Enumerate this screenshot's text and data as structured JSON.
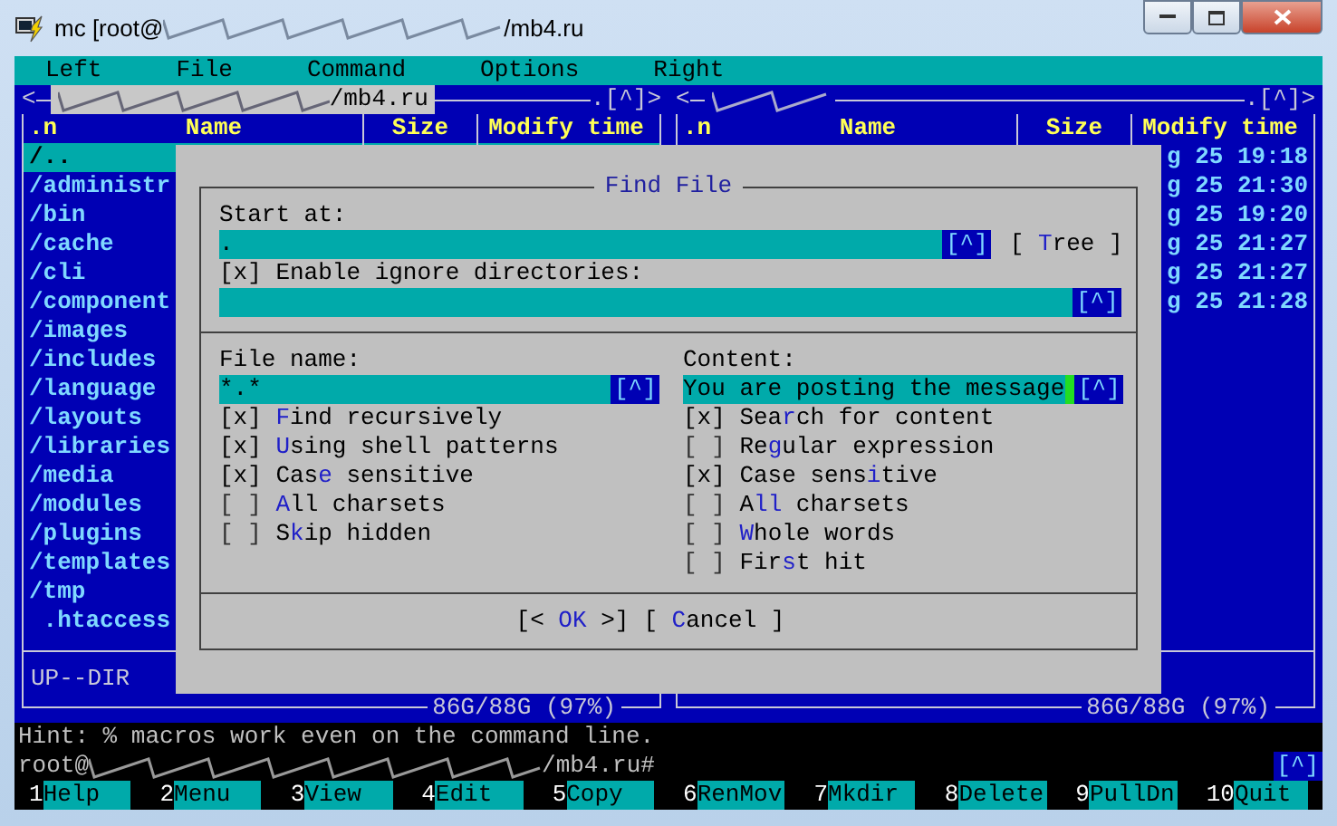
{
  "window": {
    "title_prefix": "mc [root@",
    "title_suffix": "/mb4.ru"
  },
  "menu": [
    {
      "label": "Left"
    },
    {
      "label": "File"
    },
    {
      "label": "Command"
    },
    {
      "label": "Options"
    },
    {
      "label": "Right"
    }
  ],
  "panels": [
    {
      "marker": "<",
      "path": "/mb4.ru",
      "active": true,
      "history": ".[^]>",
      "sort": ".n",
      "columns": [
        "Name",
        "Size",
        "Modify time"
      ],
      "status": "UP--DIR",
      "free": "86G/88G (97%)",
      "rows": [
        {
          "name": "/..",
          "selected": true
        },
        {
          "name": "/administr",
          "selected": false
        },
        {
          "name": "/bin",
          "selected": false
        },
        {
          "name": "/cache",
          "selected": false
        },
        {
          "name": "/cli",
          "selected": false
        },
        {
          "name": "/component",
          "selected": false
        },
        {
          "name": "/images",
          "selected": false
        },
        {
          "name": "/includes",
          "selected": false
        },
        {
          "name": "/language",
          "selected": false
        },
        {
          "name": "/layouts",
          "selected": false
        },
        {
          "name": "/libraries",
          "selected": false
        },
        {
          "name": "/media",
          "selected": false
        },
        {
          "name": "/modules",
          "selected": false
        },
        {
          "name": "/plugins",
          "selected": false
        },
        {
          "name": "/templates",
          "selected": false
        },
        {
          "name": "/tmp",
          "selected": false
        },
        {
          "name": " .htaccess",
          "selected": false
        }
      ]
    },
    {
      "marker": "<",
      "active": false,
      "history": ".[^]>",
      "sort": ".n",
      "columns": [
        "Name",
        "Size",
        "Modify time"
      ],
      "free": "86G/88G (97%)",
      "rows": [
        {
          "modified": "g 25 19:18",
          "selected": false
        },
        {
          "modified": "g 25 21:30",
          "selected": false
        },
        {
          "modified": "g 25 19:20",
          "selected": false
        },
        {
          "modified": "g 25 21:27",
          "selected": false
        },
        {
          "modified": "g 25 21:27",
          "selected": false
        },
        {
          "modified": "g 25 21:28",
          "selected": false
        }
      ]
    }
  ],
  "dialog": {
    "title": "Find File",
    "start_label": "Start at:",
    "start_value": ".",
    "start_history": "[^]",
    "tree_button": {
      "pre": "[ ",
      "hot": "T",
      "post": "ree ]"
    },
    "ignore": {
      "checked": true,
      "box": "[x]",
      "post": "Enable ignore directories:"
    },
    "ignore_history": "[^]",
    "file_label": "File name:",
    "file_value": "*.*",
    "file_history": "[^]",
    "content_label": "Content:",
    "content_value": "You are posting the message",
    "content_history": "[^]",
    "left_options": [
      {
        "checked": true,
        "box": "[x]",
        "hot": "F",
        "post": "ind recursively"
      },
      {
        "checked": true,
        "box": "[x]",
        "hot": "U",
        "post": "sing shell patterns"
      },
      {
        "checked": true,
        "box": "[x]",
        "pre": "Cas",
        "hot": "e",
        "post": " sensitive"
      },
      {
        "checked": false,
        "box": "[ ]",
        "hot": "A",
        "post": "ll charsets"
      },
      {
        "checked": false,
        "box": "[ ]",
        "pre": "S",
        "hot": "k",
        "post": "ip hidden"
      }
    ],
    "right_options": [
      {
        "checked": true,
        "box": "[x]",
        "pre": "Sea",
        "hot": "r",
        "post": "ch for content"
      },
      {
        "checked": false,
        "box": "[ ]",
        "pre": "Re",
        "hot": "g",
        "post": "ular expression"
      },
      {
        "checked": true,
        "box": "[x]",
        "pre": "Case sens",
        "hot": "i",
        "post": "tive"
      },
      {
        "checked": false,
        "box": "[ ]",
        "pre": "A",
        "hot": "ll",
        "post": " charsets"
      },
      {
        "checked": false,
        "box": "[ ]",
        "hot": "W",
        "post": "hole words"
      },
      {
        "checked": false,
        "box": "[ ]",
        "pre": "Fir",
        "hot": "s",
        "post": "t hit"
      }
    ],
    "buttons": [
      {
        "pre": "[< ",
        "hot": "OK",
        "post": " >]"
      },
      {
        "pre": "[ ",
        "hot": "C",
        "post": "ancel ]"
      }
    ]
  },
  "hint": "Hint: % macros work even on the command line.",
  "command_line": {
    "prefix": "root@",
    "suffix": "/mb4.ru#",
    "history": "[^]"
  },
  "function_keys": [
    {
      "num": "1",
      "label": "Help"
    },
    {
      "num": "2",
      "label": "Menu"
    },
    {
      "num": "3",
      "label": "View"
    },
    {
      "num": "4",
      "label": "Edit"
    },
    {
      "num": "5",
      "label": "Copy"
    },
    {
      "num": "6",
      "label": "RenMov"
    },
    {
      "num": "7",
      "label": "Mkdir"
    },
    {
      "num": "8",
      "label": "Delete"
    },
    {
      "num": "9",
      "label": "PullDn"
    },
    {
      "num": "10",
      "label": "Quit"
    }
  ]
}
